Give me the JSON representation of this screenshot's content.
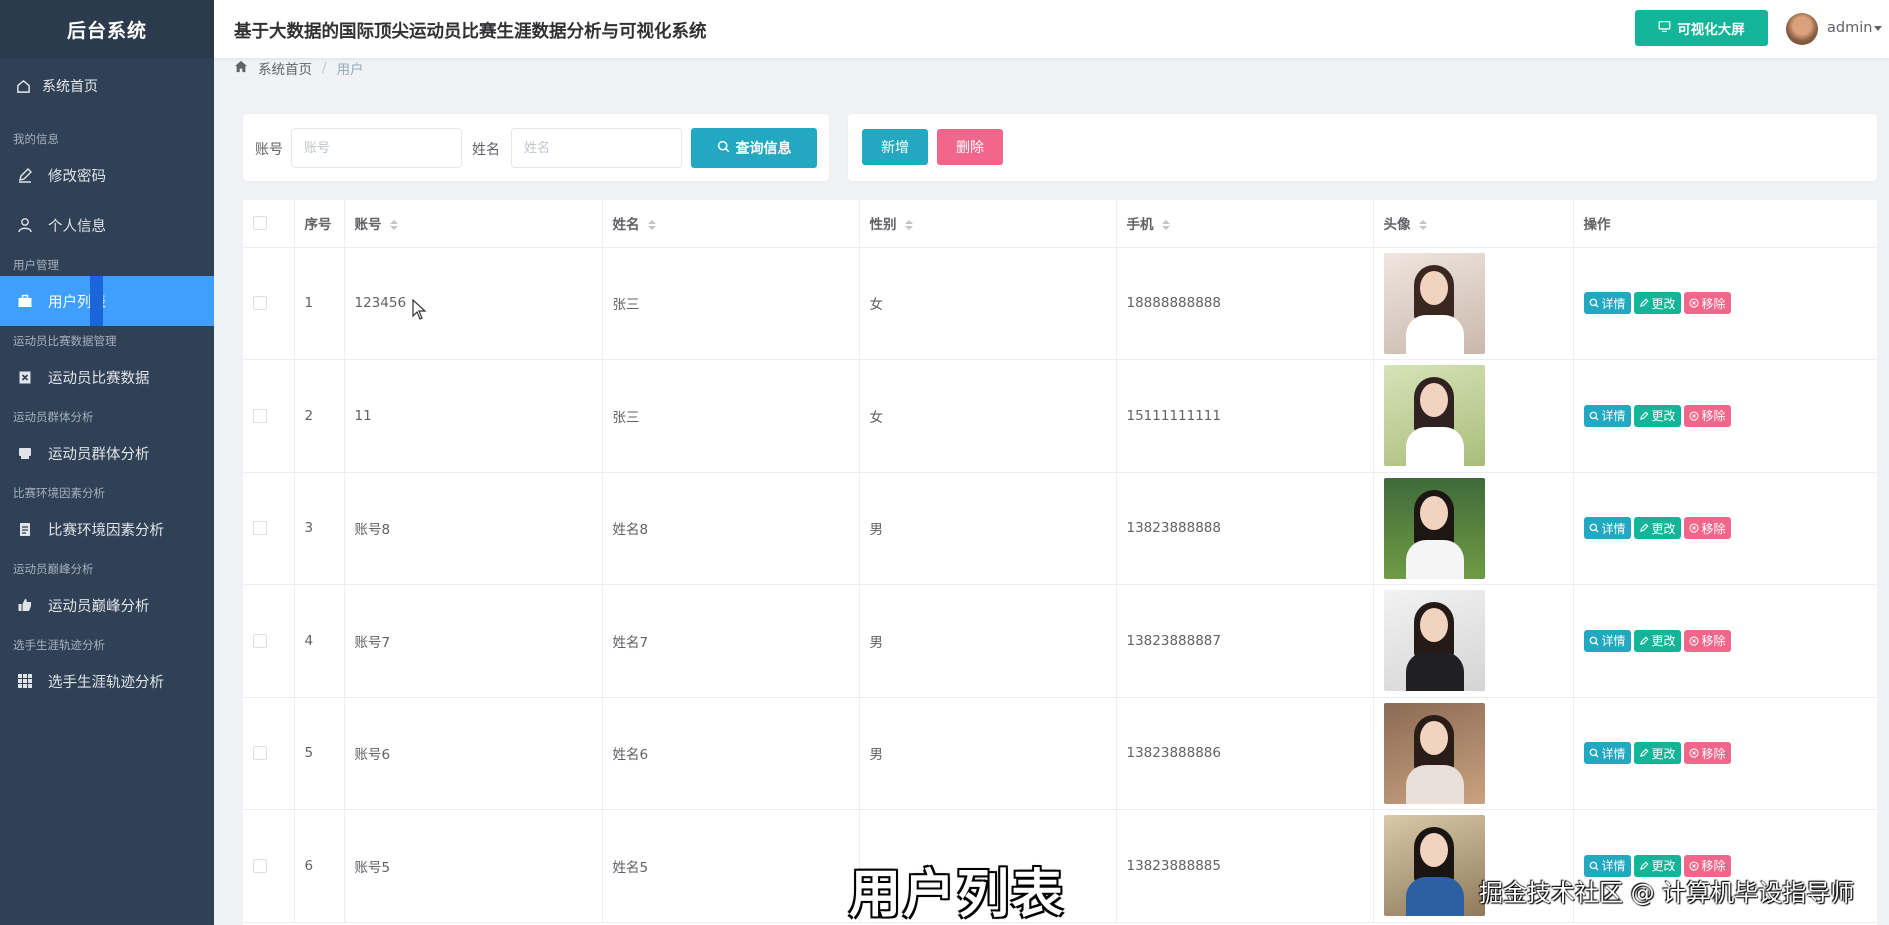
{
  "sidebar": {
    "brand": "后台系统",
    "home": "系统首页",
    "groups": [
      {
        "title": "我的信息",
        "items": [
          "修改密码",
          "个人信息"
        ]
      },
      {
        "title": "用户管理",
        "items": [
          "用户列表"
        ]
      },
      {
        "title": "运动员比赛数据管理",
        "items": [
          "运动员比赛数据"
        ]
      },
      {
        "title": "运动员群体分析",
        "items": [
          "运动员群体分析"
        ]
      },
      {
        "title": "比赛环境因素分析",
        "items": [
          "比赛环境因素分析"
        ]
      },
      {
        "title": "运动员巅峰分析",
        "items": [
          "运动员巅峰分析"
        ]
      },
      {
        "title": "选手生涯轨迹分析",
        "items": [
          "选手生涯轨迹分析"
        ]
      }
    ]
  },
  "header": {
    "title": "基于大数据的国际顶尖运动员比赛生涯数据分析与可视化系统",
    "screen_button": "可视化大屏",
    "user": "admin"
  },
  "breadcrumb": {
    "home": "系统首页",
    "sep": "/",
    "current": "用户"
  },
  "search": {
    "account_label": "账号",
    "account_placeholder": "账号",
    "name_label": "姓名",
    "name_placeholder": "姓名",
    "query_button": "查询信息"
  },
  "toolbar": {
    "add": "新增",
    "delete": "删除"
  },
  "table": {
    "columns": [
      "序号",
      "账号",
      "姓名",
      "性别",
      "手机",
      "头像",
      "操作"
    ],
    "rows": [
      {
        "no": "1",
        "account": "123456",
        "name": "张三",
        "gender": "女",
        "phone": "18888888888"
      },
      {
        "no": "2",
        "account": "11",
        "name": "张三",
        "gender": "女",
        "phone": "15111111111"
      },
      {
        "no": "3",
        "account": "账号8",
        "name": "姓名8",
        "gender": "男",
        "phone": "13823888888"
      },
      {
        "no": "4",
        "account": "账号7",
        "name": "姓名7",
        "gender": "男",
        "phone": "13823888887"
      },
      {
        "no": "5",
        "account": "账号6",
        "name": "姓名6",
        "gender": "男",
        "phone": "13823888886"
      },
      {
        "no": "6",
        "account": "账号5",
        "name": "姓名5",
        "gender": "",
        "phone": "13823888885"
      }
    ],
    "actions": {
      "detail": "详情",
      "edit": "更改",
      "remove": "移除"
    }
  },
  "overlay": {
    "subtitle": "用户列表",
    "watermark": "掘金技术社区 @ 计算机毕设指导师"
  },
  "colors": {
    "sidebar": "#304156",
    "active": "#409eff",
    "primary": "#22a8c0",
    "success": "#13b497",
    "danger": "#f1668b"
  }
}
